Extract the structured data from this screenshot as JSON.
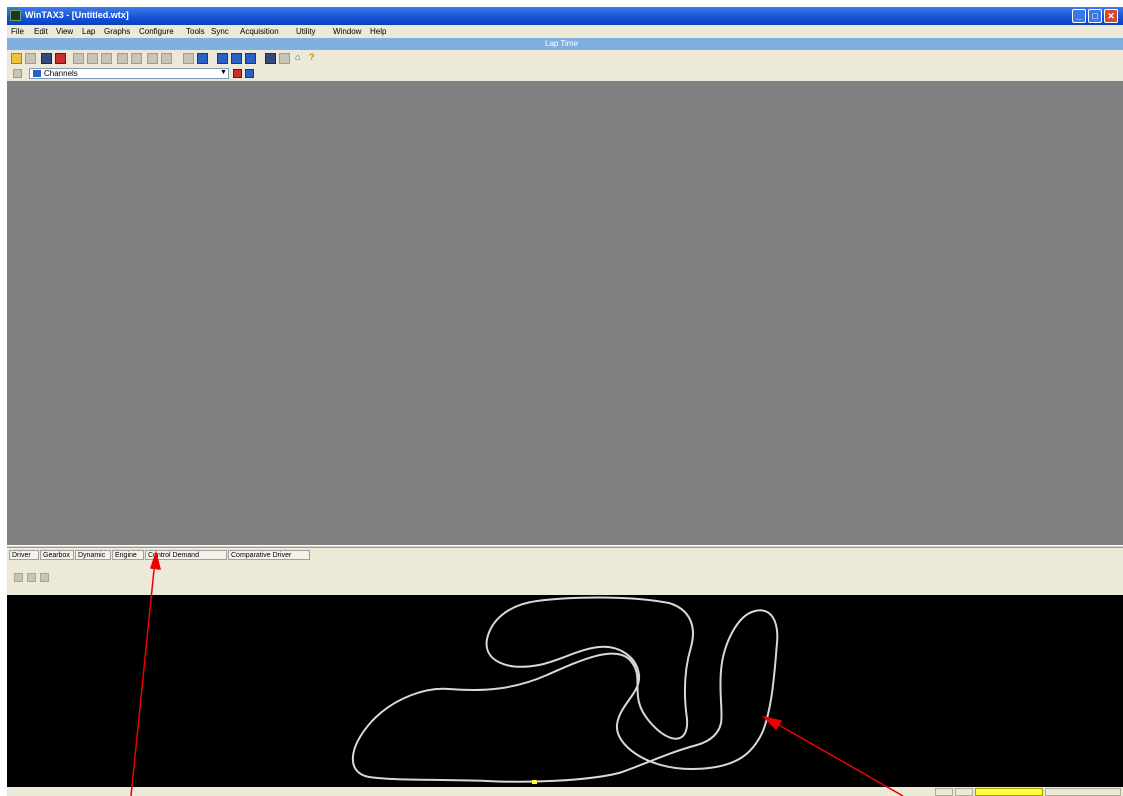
{
  "window": {
    "title": "WinTAX3 - [Untitled.wtx]",
    "controls": {
      "minimize": "_",
      "maximize": "□",
      "close": "✕"
    }
  },
  "menu": [
    "File",
    "Edit",
    "View",
    "Lap",
    "Graphs",
    "Configure",
    "Tools",
    "Sync",
    "Acquisition",
    "Utility",
    "Window",
    "Help"
  ],
  "subtitle": "Lap Time",
  "toolbar": {
    "icons": [
      "open-folder-icon",
      "open-file-icon",
      "print-icon",
      "save-icon",
      "cut-icon",
      "copy-icon",
      "paste-icon",
      "undo-icon",
      "redo-icon",
      "prev-icon",
      "next-icon",
      "zoom-icon",
      "graph-icon",
      "table-icon",
      "layout-icon",
      "settings-icon",
      "info-icon",
      "home-icon",
      "help-icon"
    ]
  },
  "combo": {
    "value": "Channels"
  },
  "panel_tabs": [
    "Driver",
    "Gearbox",
    "Dynamic",
    "Engine",
    "Control Demand",
    "Comparative Driver"
  ],
  "status": {
    "highlight_value": ""
  },
  "colors": {
    "title_bar": "#1552d6",
    "subtitle_bar": "#7fb0e0",
    "workspace": "#808080",
    "track_bg": "#000000",
    "track_line": "#d8d8d8",
    "marker": "#ffff40",
    "annotation_arrow": "#ee0000"
  }
}
